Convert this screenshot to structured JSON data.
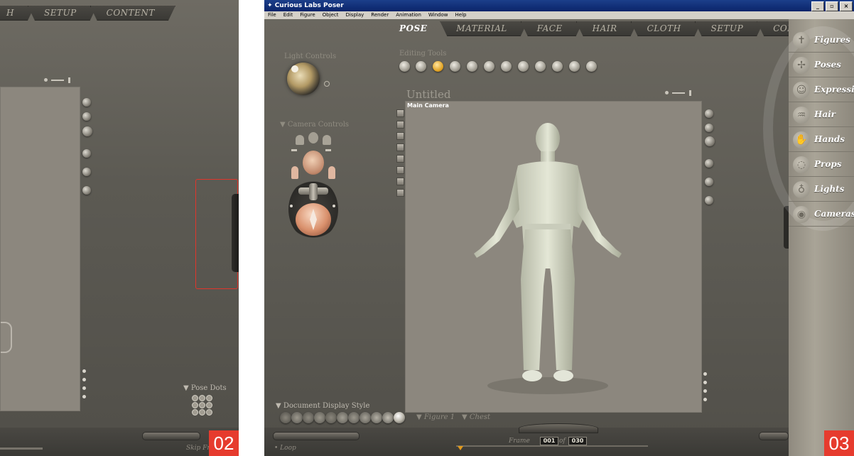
{
  "panel2": {
    "tabs": [
      {
        "label": "H",
        "active": false
      },
      {
        "label": "SETUP",
        "active": false
      },
      {
        "label": "CONTENT",
        "active": false
      }
    ],
    "pose_dots_label": "▼ Pose Dots",
    "skip_label": "Skip Fr",
    "badge": "02"
  },
  "panel3": {
    "title": "Curious Labs Poser",
    "menu": [
      "File",
      "Edit",
      "Figure",
      "Object",
      "Display",
      "Render",
      "Animation",
      "Window",
      "Help"
    ],
    "tabs": [
      {
        "label": "POSE",
        "active": true
      },
      {
        "label": "MATERIAL",
        "active": false
      },
      {
        "label": "FACE",
        "active": false
      },
      {
        "label": "HAIR",
        "active": false
      },
      {
        "label": "CLOTH",
        "active": false
      },
      {
        "label": "SETUP",
        "active": false
      },
      {
        "label": "CONTENT",
        "active": false
      }
    ],
    "light_controls_label": "Light Controls",
    "editing_tools_label": "Editing Tools",
    "camera_controls_label": "▼ Camera Controls",
    "document_title": "Untitled",
    "camera_name": "Main Camera",
    "document_display_style_label": "▼ Document Display Style",
    "figure_select": "▼ Figure 1",
    "part_select": "▼ Chest",
    "loop_label": "Loop",
    "frame_label": "Frame",
    "frame_current": "001",
    "frame_of": "of",
    "frame_total": "030",
    "badge": "03",
    "palette": [
      {
        "label": "Figures",
        "icon": "figure-icon"
      },
      {
        "label": "Poses",
        "icon": "running-figure-icon"
      },
      {
        "label": "Expression",
        "icon": "face-icon"
      },
      {
        "label": "Hair",
        "icon": "hair-icon"
      },
      {
        "label": "Hands",
        "icon": "hand-icon"
      },
      {
        "label": "Props",
        "icon": "prop-icon"
      },
      {
        "label": "Lights",
        "icon": "bulb-icon"
      },
      {
        "label": "Cameras",
        "icon": "camera-icon"
      }
    ]
  }
}
